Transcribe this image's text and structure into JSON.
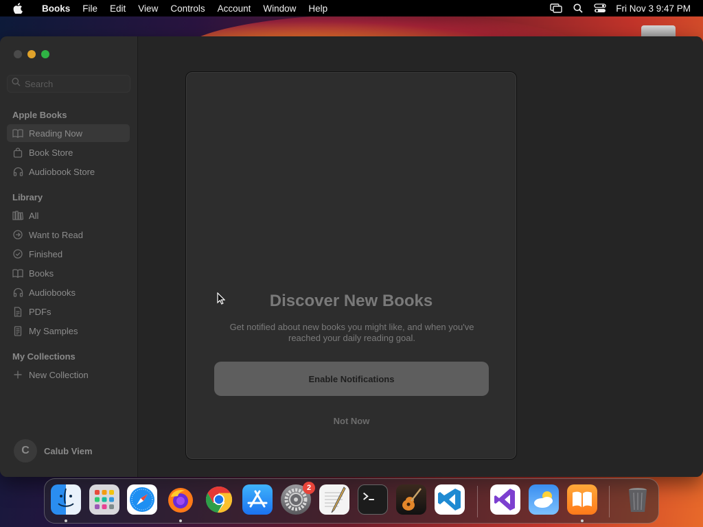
{
  "menubar": {
    "app_name": "Books",
    "items": [
      "File",
      "Edit",
      "View",
      "Controls",
      "Account",
      "Window",
      "Help"
    ],
    "datetime": "Fri Nov 3  9:47 PM"
  },
  "sidebar": {
    "search_placeholder": "Search",
    "sections": {
      "apple_books": "Apple Books",
      "library": "Library",
      "collections": "My Collections"
    },
    "apple_books_items": [
      {
        "label": "Reading Now",
        "icon": "open-book-icon",
        "active": true
      },
      {
        "label": "Book Store",
        "icon": "shopping-bag-icon"
      },
      {
        "label": "Audiobook Store",
        "icon": "headphones-icon"
      }
    ],
    "library_items": [
      {
        "label": "All",
        "icon": "books-shelf-icon"
      },
      {
        "label": "Want to Read",
        "icon": "arrow-circle-icon"
      },
      {
        "label": "Finished",
        "icon": "checkmark-circle-icon"
      },
      {
        "label": "Books",
        "icon": "open-book-icon"
      },
      {
        "label": "Audiobooks",
        "icon": "headphones-icon"
      },
      {
        "label": "PDFs",
        "icon": "document-icon"
      },
      {
        "label": "My Samples",
        "icon": "sample-doc-icon"
      }
    ],
    "new_collection": "New Collection",
    "user": {
      "initial": "C",
      "name": "Calub Viem"
    }
  },
  "dialog": {
    "title": "Discover New Books",
    "message": "Get notified about new books you might like, and when you've reached your daily reading goal.",
    "primary_button": "Enable Notifications",
    "secondary_button": "Not Now"
  },
  "dock": {
    "apps": [
      "Finder",
      "Launchpad",
      "Safari",
      "Firefox",
      "Chrome",
      "App Store",
      "System Settings",
      "TextEdit",
      "Terminal",
      "GarageBand",
      "Visual Studio Code",
      "Visual Studio",
      "Weather",
      "Books",
      "Trash"
    ],
    "settings_badge": "2"
  },
  "colors": {
    "window_bg": "#262626",
    "sidebar_bg": "#2b2b2b",
    "dialog_bg": "#2d2d2d",
    "primary_button_bg": "#5e5e5e"
  }
}
